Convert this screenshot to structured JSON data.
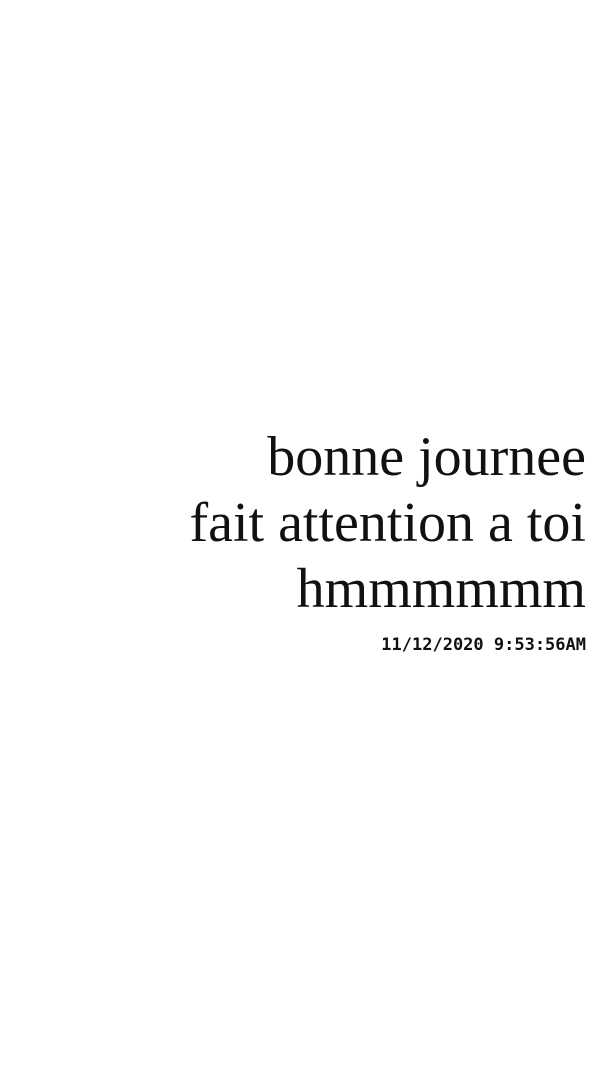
{
  "message": {
    "lines": [
      "bonne journee",
      "fait attention a toi",
      "hmmmmmm"
    ],
    "timestamp": "11/12/2020 9:53:56AM"
  },
  "colors": {
    "background": "#ffffff",
    "text": "#111111"
  }
}
